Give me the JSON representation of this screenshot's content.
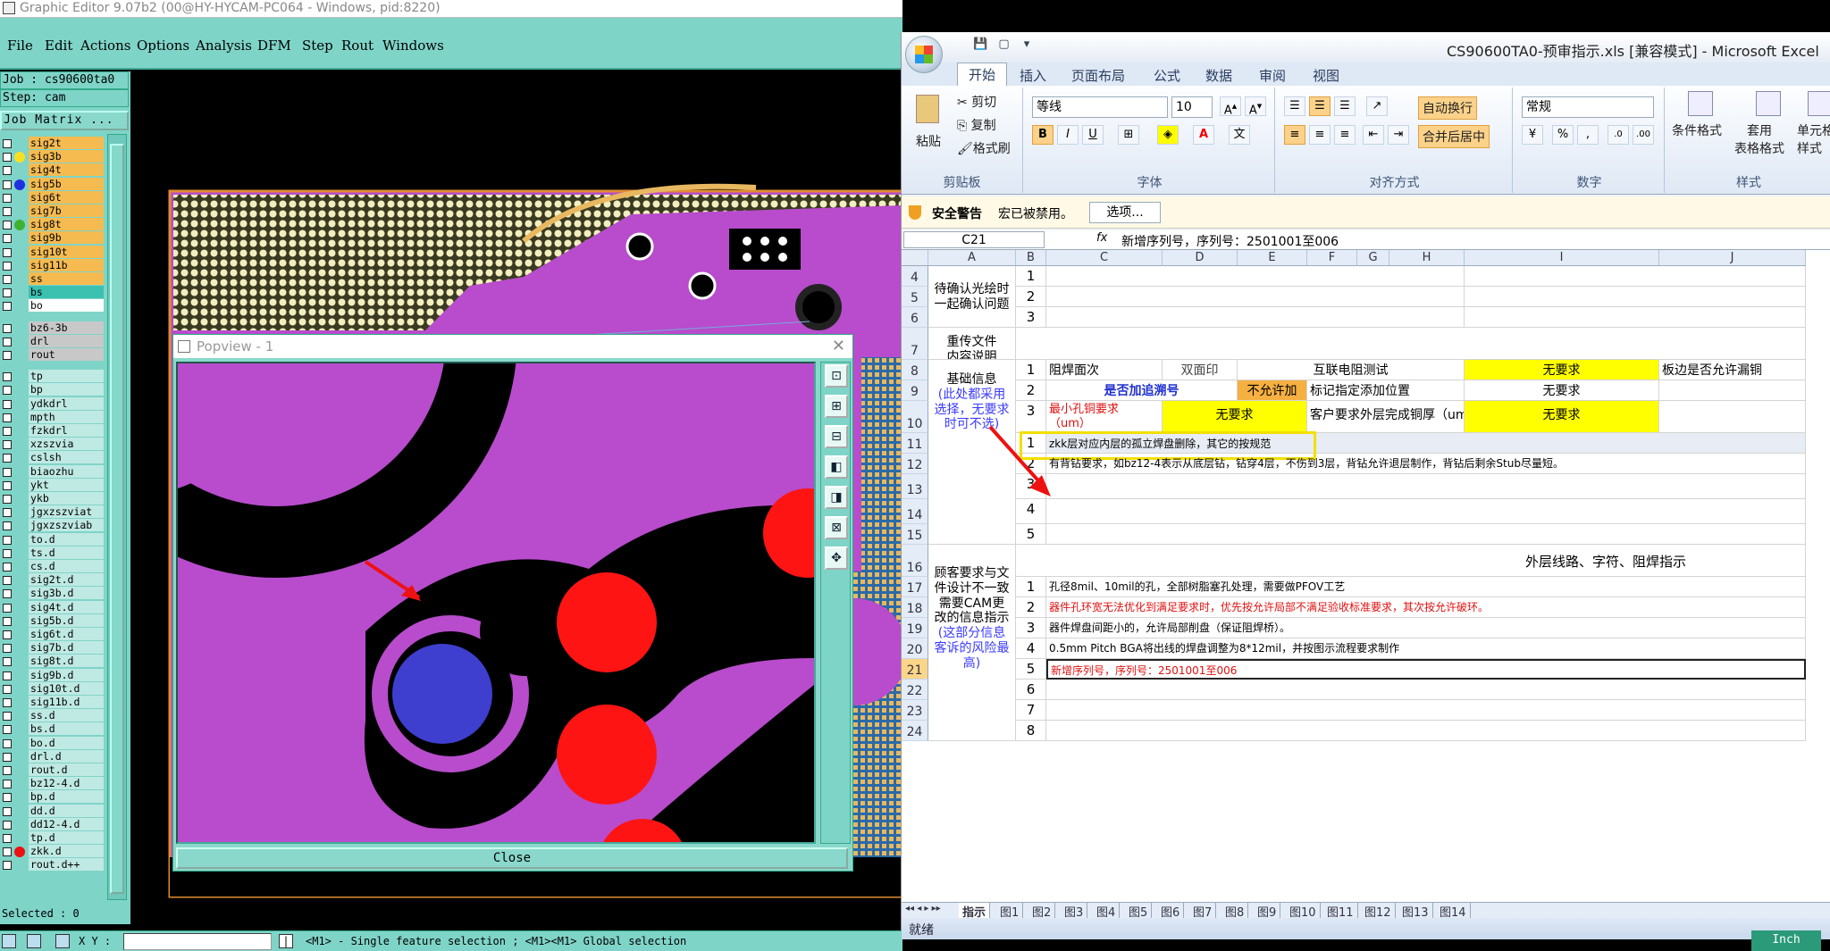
{
  "ge": {
    "title": "Graphic Editor 9.07b2 (00@HY-HYCAM-PC064 - Windows, pid:8220)",
    "menu": [
      "File",
      "Edit",
      "Actions",
      "Options",
      "Analysis",
      "DFM",
      "Step",
      "Rout",
      "Windows"
    ],
    "job": "Job : cs90600ta0",
    "step": "Step: cam",
    "job_matrix": "Job Matrix ...",
    "layers": [
      {
        "name": "sig2t",
        "dot": "",
        "style": "orange"
      },
      {
        "name": "sig3b",
        "dot": "#f8e020",
        "style": "orange"
      },
      {
        "name": "sig4t",
        "dot": "",
        "style": "orange"
      },
      {
        "name": "sig5b",
        "dot": "#2030e0",
        "style": "orange"
      },
      {
        "name": "sig6t",
        "dot": "",
        "style": "orange"
      },
      {
        "name": "sig7b",
        "dot": "",
        "style": "orange"
      },
      {
        "name": "sig8t",
        "dot": "#40b030",
        "style": "orange"
      },
      {
        "name": "sig9b",
        "dot": "",
        "style": "orange"
      },
      {
        "name": "sig10t",
        "dot": "",
        "style": "orange"
      },
      {
        "name": "sig11b",
        "dot": "",
        "style": "orange"
      },
      {
        "name": "ss",
        "dot": "",
        "style": "orange"
      },
      {
        "name": "bs",
        "dot": "",
        "style": "teal"
      },
      {
        "name": "bo",
        "dot": "",
        "style": "white"
      },
      {
        "name": "",
        "dot": "",
        "style": "gap"
      },
      {
        "name": "bz6-3b",
        "dot": "",
        "style": "grey"
      },
      {
        "name": "drl",
        "dot": "",
        "style": "grey"
      },
      {
        "name": "rout",
        "dot": "",
        "style": "grey"
      },
      {
        "name": "",
        "dot": "",
        "style": "gap"
      },
      {
        "name": "tp",
        "dot": "",
        "style": "cyan"
      },
      {
        "name": "bp",
        "dot": "",
        "style": "cyan"
      },
      {
        "name": "ydkdrl",
        "dot": "",
        "style": "cyan"
      },
      {
        "name": "mpth",
        "dot": "",
        "style": "cyan"
      },
      {
        "name": "fzkdrl",
        "dot": "",
        "style": "cyan"
      },
      {
        "name": "xzszvia",
        "dot": "",
        "style": "cyan"
      },
      {
        "name": "cslsh",
        "dot": "",
        "style": "cyan"
      },
      {
        "name": "biaozhu",
        "dot": "",
        "style": "cyan"
      },
      {
        "name": "ykt",
        "dot": "",
        "style": "cyan"
      },
      {
        "name": "ykb",
        "dot": "",
        "style": "cyan"
      },
      {
        "name": "jgxzszviat",
        "dot": "",
        "style": "cyan"
      },
      {
        "name": "jgxzszviab",
        "dot": "",
        "style": "cyan"
      },
      {
        "name": "to.d",
        "dot": "",
        "style": "cyan"
      },
      {
        "name": "ts.d",
        "dot": "",
        "style": "cyan"
      },
      {
        "name": "cs.d",
        "dot": "",
        "style": "cyan"
      },
      {
        "name": "sig2t.d",
        "dot": "",
        "style": "cyan"
      },
      {
        "name": "sig3b.d",
        "dot": "",
        "style": "cyan"
      },
      {
        "name": "sig4t.d",
        "dot": "",
        "style": "cyan"
      },
      {
        "name": "sig5b.d",
        "dot": "",
        "style": "cyan"
      },
      {
        "name": "sig6t.d",
        "dot": "",
        "style": "cyan"
      },
      {
        "name": "sig7b.d",
        "dot": "",
        "style": "cyan"
      },
      {
        "name": "sig8t.d",
        "dot": "",
        "style": "cyan"
      },
      {
        "name": "sig9b.d",
        "dot": "",
        "style": "cyan"
      },
      {
        "name": "sig10t.d",
        "dot": "",
        "style": "cyan"
      },
      {
        "name": "sig11b.d",
        "dot": "",
        "style": "cyan"
      },
      {
        "name": "ss.d",
        "dot": "",
        "style": "cyan"
      },
      {
        "name": "bs.d",
        "dot": "",
        "style": "cyan"
      },
      {
        "name": "bo.d",
        "dot": "",
        "style": "cyan"
      },
      {
        "name": "drl.d",
        "dot": "",
        "style": "cyan"
      },
      {
        "name": "rout.d",
        "dot": "",
        "style": "cyan"
      },
      {
        "name": "bz12-4.d",
        "dot": "",
        "style": "cyan"
      },
      {
        "name": "bp.d",
        "dot": "",
        "style": "cyan"
      },
      {
        "name": "dd.d",
        "dot": "",
        "style": "cyan"
      },
      {
        "name": "dd12-4.d",
        "dot": "",
        "style": "cyan"
      },
      {
        "name": "tp.d",
        "dot": "",
        "style": "cyan"
      },
      {
        "name": "zkk.d",
        "dot": "#ee1010",
        "style": "cyan"
      },
      {
        "name": "rout.d++",
        "dot": "",
        "style": "cyan"
      }
    ],
    "selected": "Selected : 0",
    "xy_label": "X Y :",
    "status_msg": "<M1> - Single feature selection ; <M1><M1> Global selection",
    "units": "Inch",
    "popview": {
      "title": "Popview - 1",
      "close": "Close"
    }
  },
  "excel": {
    "title": "CS90600TA0-预审指示.xls  [兼容模式] - Microsoft Excel",
    "tabs": [
      "开始",
      "插入",
      "页面布局",
      "公式",
      "数据",
      "审阅",
      "视图"
    ],
    "clipboard": {
      "paste": "粘贴",
      "cut": "剪切",
      "copy": "复制",
      "format_painter": "格式刷",
      "label": "剪贴板"
    },
    "font": {
      "name": "等线",
      "size": "10",
      "label": "字体"
    },
    "align": {
      "wrap": "自动换行",
      "merge": "合并后居中",
      "label": "对齐方式"
    },
    "number": {
      "format": "常规",
      "label": "数字"
    },
    "styles": {
      "cond": "条件格式",
      "table": "套用\n表格格式",
      "cell": "单元格\n样式",
      "label": "样式"
    },
    "security": {
      "title": "安全警告",
      "msg": "宏已被禁用。",
      "btn": "选项..."
    },
    "namebox": "C21",
    "formula": "新增序列号，序列号：2501001至006",
    "columns": [
      "A",
      "B",
      "C",
      "D",
      "E",
      "F",
      "G",
      "H",
      "I",
      "J"
    ],
    "rows": [
      "4",
      "5",
      "6",
      "7",
      "8",
      "9",
      "10",
      "11",
      "12",
      "13",
      "14",
      "15",
      "16",
      "17",
      "18",
      "19",
      "20",
      "21",
      "22",
      "23",
      "24"
    ],
    "cells": {
      "a4": "待确认光绘时\n一起确认问题",
      "a7": "重传文件\n内容说明",
      "a8": "基础信息",
      "a8b": "(此处都采用\n选择，无要求\n时可不选)",
      "a16": "顾客要求与文\n件设计不一致\n需要CAM更\n改的信息指示",
      "a16b": "(这部分信息\n客诉的风险最\n高)",
      "b": [
        "1",
        "2",
        "3",
        "1",
        "2",
        "3",
        "1",
        "2",
        "3",
        "4",
        "5",
        "1",
        "2",
        "3",
        "4",
        "5",
        "6",
        "7",
        "8"
      ],
      "r8_c": "阻焊面次",
      "r8_d": "双面印",
      "r8_ef": "互联电阻测试",
      "r8_i": "无要求",
      "r8_j": "板边是否允许漏铜",
      "r9_c": "是否加追溯号",
      "r9_e": "不允许加",
      "r9_fh": "标记指定添加位置",
      "r9_i": "无要求",
      "r10_c": "最小孔铜要求\n（um）",
      "r10_d": "无要求",
      "r10_fh": "客户要求外层完成铜厚（um）",
      "r10_i": "无要求",
      "r11": "zkk层对应内层的孤立焊盘删除，其它的按规范",
      "r12": "有背钻要求，如bz12-4表示从底层钻，钻穿4层，不伤到3层，背钻允许退层制作，背钻后剩余Stub尽量短。",
      "r16": "外层线路、字符、阻焊指示",
      "r17": "孔径8mil、10mil的孔，全部树脂塞孔处理，需要做PFOV工艺",
      "r18": "器件孔环宽无法优化到满足要求时，优先按允许局部不满足验收标准要求，其次按允许破环。",
      "r19": "器件焊盘间距小的，允许局部削盘（保证阻焊桥）。",
      "r20": "0.5mm Pitch BGA将出线的焊盘调整为8*12mil，并按图示流程要求制作",
      "r21": "新增序列号，序列号：2501001至006"
    },
    "sheet_tabs": [
      "指示",
      "图1",
      "图2",
      "图3",
      "图4",
      "图5",
      "图6",
      "图7",
      "图8",
      "图9",
      "图10",
      "图11",
      "图12",
      "图13",
      "图14"
    ],
    "status": "就绪"
  },
  "colors": {
    "ge_bg": "#7fd4c8",
    "purple": "#b84ccc",
    "red": "#ff1414",
    "blue": "#3e3ecf",
    "highlight": "#ffff00"
  }
}
